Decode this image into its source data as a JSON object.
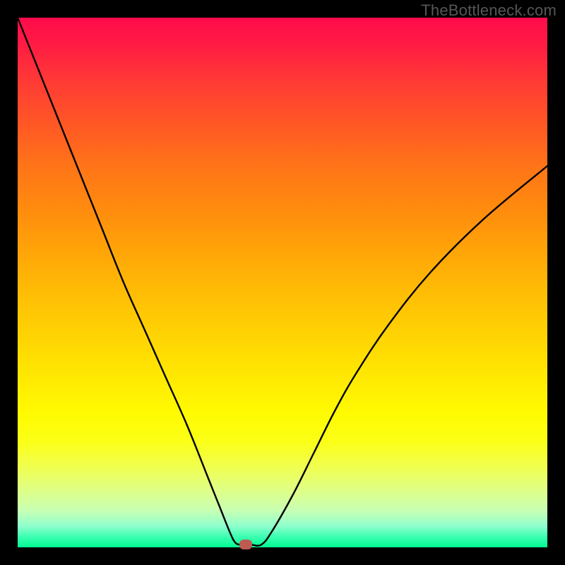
{
  "watermark": "TheBottleneck.com",
  "chart_data": {
    "type": "line",
    "title": "",
    "xlabel": "",
    "ylabel": "",
    "xlim": [
      0,
      100
    ],
    "ylim": [
      0,
      100
    ],
    "grid": false,
    "background_gradient": {
      "top": "#ff0b4b",
      "mid": "#ffd303",
      "bottom": "#00fb91"
    },
    "series": [
      {
        "name": "bottleneck-curve",
        "color": "#000000",
        "x": [
          0,
          4,
          8,
          12,
          16,
          20,
          24,
          28,
          32,
          36,
          38,
          40,
          41,
          42,
          44,
          46,
          48,
          52,
          56,
          60,
          64,
          70,
          78,
          88,
          100
        ],
        "y": [
          100,
          90,
          80,
          70,
          60,
          50,
          41,
          32,
          23,
          13,
          8,
          3,
          1,
          0.5,
          0.5,
          0.5,
          3,
          10,
          18,
          26,
          33,
          42,
          52,
          62,
          72
        ]
      }
    ],
    "marker": {
      "name": "optimal-point",
      "x": 43,
      "y": 0.5,
      "color": "#bd5a52"
    }
  }
}
